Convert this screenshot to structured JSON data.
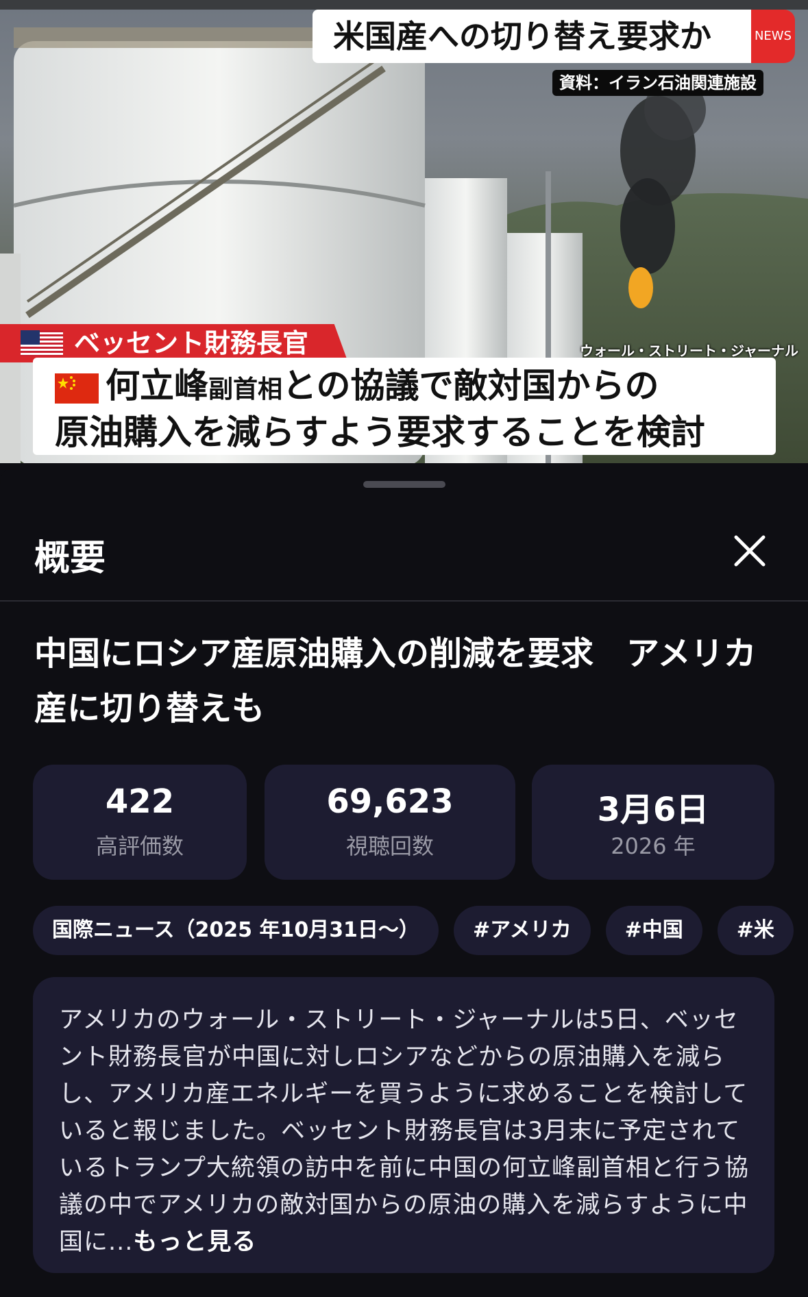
{
  "video": {
    "headline": "米国産への切り替え要求か",
    "news_badge": "NEWS",
    "source_label": "資料：イラン石油関連施設",
    "speaker": "ベッセント財務長官",
    "credit": "ウォール・ストリート・ジャーナル",
    "caption_name": "何立峰",
    "caption_role": "副首相",
    "caption_line1_rest": "との協議で敵対国からの",
    "caption_line2": "原油購入を減らすよう要求することを検討"
  },
  "sheet": {
    "title": "概要",
    "video_title": "中国にロシア産原油購入の削減を要求　アメリカ産に切り替えも",
    "stats": [
      {
        "value": "422",
        "label": "高評価数"
      },
      {
        "value": "69,623",
        "label": "視聴回数"
      },
      {
        "value": "3月6日",
        "label": "2026 年"
      }
    ],
    "chips": [
      "国際ニュース（2025 年10月31日〜）",
      "#アメリカ",
      "#中国",
      "#米"
    ],
    "description": "アメリカのウォール・ストリート・ジャーナルは5日、ベッセント財務長官が中国に対しロシアなどからの原油購入を減らし、アメリカ産エネルギーを買うように求めることを検討していると報じました。ベッセント財務長官は3月末に予定されているトランプ大統領の訪中を前に中国の何立峰副首相と行う協議の中でアメリカの敵対国からの原油の購入を減らすように中国に...",
    "more_label": "もっと見る"
  },
  "colors": {
    "card": "#1d1c31",
    "background": "#0e0e13",
    "accent_red": "#d9262b"
  }
}
